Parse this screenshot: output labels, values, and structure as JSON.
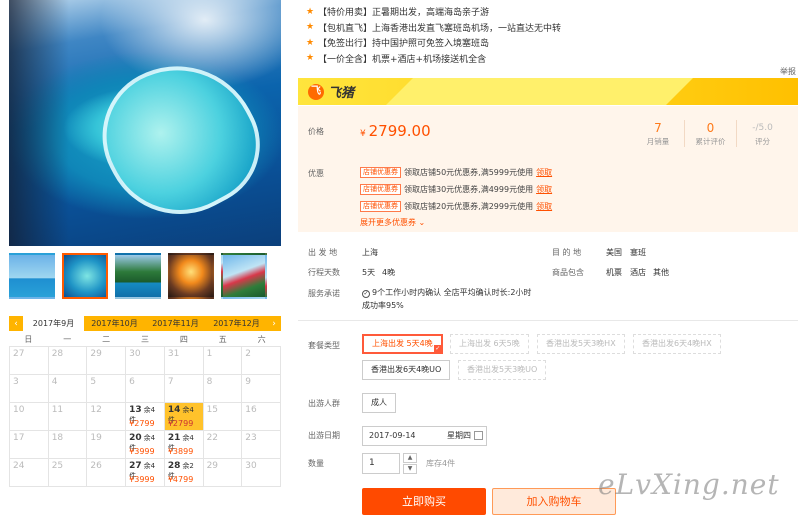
{
  "bullets": [
    "【特价用卖】正暑期出发，高端海岛亲子游",
    "【包机直飞】上海香港出发直飞塞班岛机场，一站直达无中转",
    "【免签出行】持中国护照可免签入境塞班岛",
    "【一价全含】机票+酒店+机场接送机全含"
  ],
  "report_label": "举报",
  "brand": {
    "name": "飞猪",
    "logo_glyph": "飞"
  },
  "price": {
    "label": "价格",
    "currency": "¥",
    "value": "2799.00"
  },
  "stats": [
    {
      "num": "7",
      "label": "月销量"
    },
    {
      "num": "0",
      "label": "累计评价"
    },
    {
      "num": "-/5.0",
      "label": "评分"
    }
  ],
  "coupon_section": {
    "label": "优惠",
    "tag": "店铺优惠券",
    "items": [
      "领取店铺50元优惠券,满5999元使用",
      "领取店铺30元优惠券,满4999元使用",
      "领取店铺20元优惠券,满2999元使用"
    ],
    "link": "领取",
    "more": "展开更多优惠券 ⌄"
  },
  "info": {
    "depart_label": "出 发 地",
    "depart": "上海",
    "dest_label": "目 的 地",
    "dest_country": "美国",
    "dest_city": "塞班",
    "days_label": "行程天数",
    "days": "5天",
    "nights": "4晚",
    "includes_label": "商品包含",
    "includes": [
      "机票",
      "酒店",
      "其他"
    ],
    "service_label": "服务承诺",
    "service_line1": "9个工作小时内确认 全店平均确认时长:2小时",
    "service_line2": "成功率95%"
  },
  "package": {
    "label": "套餐类型",
    "options": [
      {
        "text": "上海出发 5天4晚",
        "state": "selected"
      },
      {
        "text": "上海出发 6天5晚",
        "state": "disabled"
      },
      {
        "text": "香港出发5天3晚HX",
        "state": "disabled"
      },
      {
        "text": "香港出发6天4晚HX",
        "state": "disabled"
      },
      {
        "text": "香港出发6天4晚UO",
        "state": "normal"
      },
      {
        "text": "香港出发5天3晚UO",
        "state": "disabled"
      }
    ]
  },
  "travelers": {
    "label": "出游人群",
    "value": "成人"
  },
  "travel_date": {
    "label": "出游日期",
    "value": "2017-09-14",
    "weekday": "星期四"
  },
  "quantity": {
    "label": "数量",
    "value": "1",
    "stock": "库存4件"
  },
  "actions": {
    "buy": "立即购买",
    "cart": "加入购物车"
  },
  "watermark": "eLvXing.net",
  "calendar": {
    "prev": "‹",
    "next": "›",
    "months": [
      "2017年9月",
      "2017年10月",
      "2017年11月",
      "2017年12月"
    ],
    "active_month": 0,
    "weekdays": [
      "日",
      "一",
      "二",
      "三",
      "四",
      "五",
      "六"
    ],
    "cells": [
      {
        "d": "27"
      },
      {
        "d": "28"
      },
      {
        "d": "29"
      },
      {
        "d": "30"
      },
      {
        "d": "31"
      },
      {
        "d": "1"
      },
      {
        "d": "2"
      },
      {
        "d": "3"
      },
      {
        "d": "4"
      },
      {
        "d": "5"
      },
      {
        "d": "6"
      },
      {
        "d": "7"
      },
      {
        "d": "8"
      },
      {
        "d": "9"
      },
      {
        "d": "10"
      },
      {
        "d": "11"
      },
      {
        "d": "12"
      },
      {
        "d": "13",
        "stock": "余4件",
        "price": "¥2799"
      },
      {
        "d": "14",
        "stock": "余4件",
        "price": "¥2799",
        "selected": true
      },
      {
        "d": "15"
      },
      {
        "d": "16"
      },
      {
        "d": "17"
      },
      {
        "d": "18"
      },
      {
        "d": "19"
      },
      {
        "d": "20",
        "stock": "余4件",
        "price": "¥3999"
      },
      {
        "d": "21",
        "stock": "余4件",
        "price": "¥3899"
      },
      {
        "d": "22"
      },
      {
        "d": "23"
      },
      {
        "d": "24"
      },
      {
        "d": "25"
      },
      {
        "d": "26"
      },
      {
        "d": "27",
        "stock": "余4件",
        "price": "¥3999"
      },
      {
        "d": "28",
        "stock": "余2件",
        "price": "¥4799"
      },
      {
        "d": "29"
      },
      {
        "d": "30"
      }
    ]
  },
  "colors": {
    "accent": "#ff5000",
    "calendar_bar": "#ffb400",
    "brand_bar": "#ffd21a"
  }
}
